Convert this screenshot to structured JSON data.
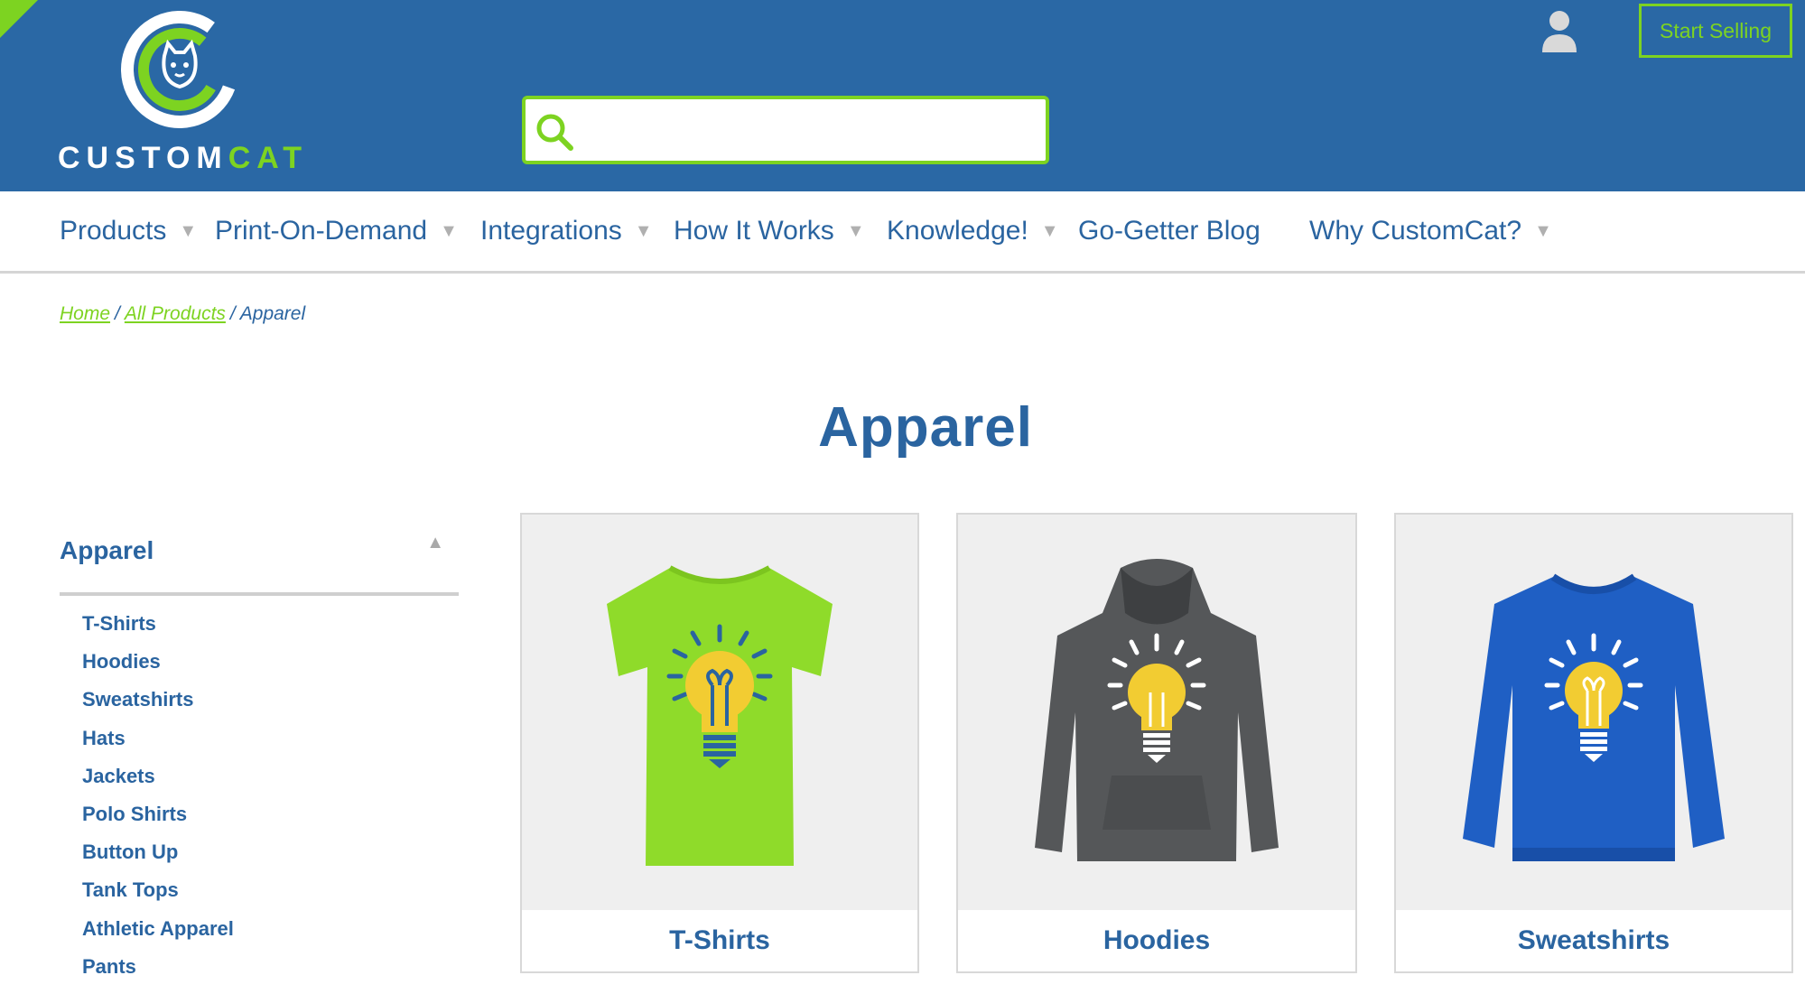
{
  "brand": {
    "logo_word_1": "CUSTOM",
    "logo_word_2": "CAT",
    "colors": {
      "header_blue": "#2a68a5",
      "accent_green": "#7dd321",
      "text_blue": "#2a64a0"
    }
  },
  "header": {
    "search_placeholder": "",
    "search_icon": "search-icon",
    "user_icon": "user-icon",
    "start_selling": "Start Selling"
  },
  "nav": {
    "items": [
      {
        "label": "Products",
        "has_caret": true
      },
      {
        "label": "Print-On-Demand",
        "has_caret": true
      },
      {
        "label": "Integrations",
        "has_caret": true
      },
      {
        "label": "How It Works",
        "has_caret": true
      },
      {
        "label": "Knowledge!",
        "has_caret": true
      },
      {
        "label": "Go-Getter Blog",
        "has_caret": false
      },
      {
        "label": "Why CustomCat?",
        "has_caret": true
      }
    ],
    "caret": "▼"
  },
  "breadcrumb": {
    "home": "Home",
    "all_products": "All Products",
    "current": "Apparel",
    "separator": "/"
  },
  "page": {
    "title": "Apparel"
  },
  "sidebar": {
    "title": "Apparel",
    "collapse_glyph": "▲",
    "items": [
      "T-Shirts",
      "Hoodies",
      "Sweatshirts",
      "Hats",
      "Jackets",
      "Polo Shirts",
      "Button Up",
      "Tank Tops",
      "Athletic Apparel",
      "Pants"
    ]
  },
  "products": [
    {
      "label": "T-Shirts",
      "garment": "t-shirt",
      "color": "#8fdb2a"
    },
    {
      "label": "Hoodies",
      "garment": "hoodie",
      "color": "#555759"
    },
    {
      "label": "Sweatshirts",
      "garment": "sweatshirt",
      "color": "#1f5fc4"
    }
  ]
}
